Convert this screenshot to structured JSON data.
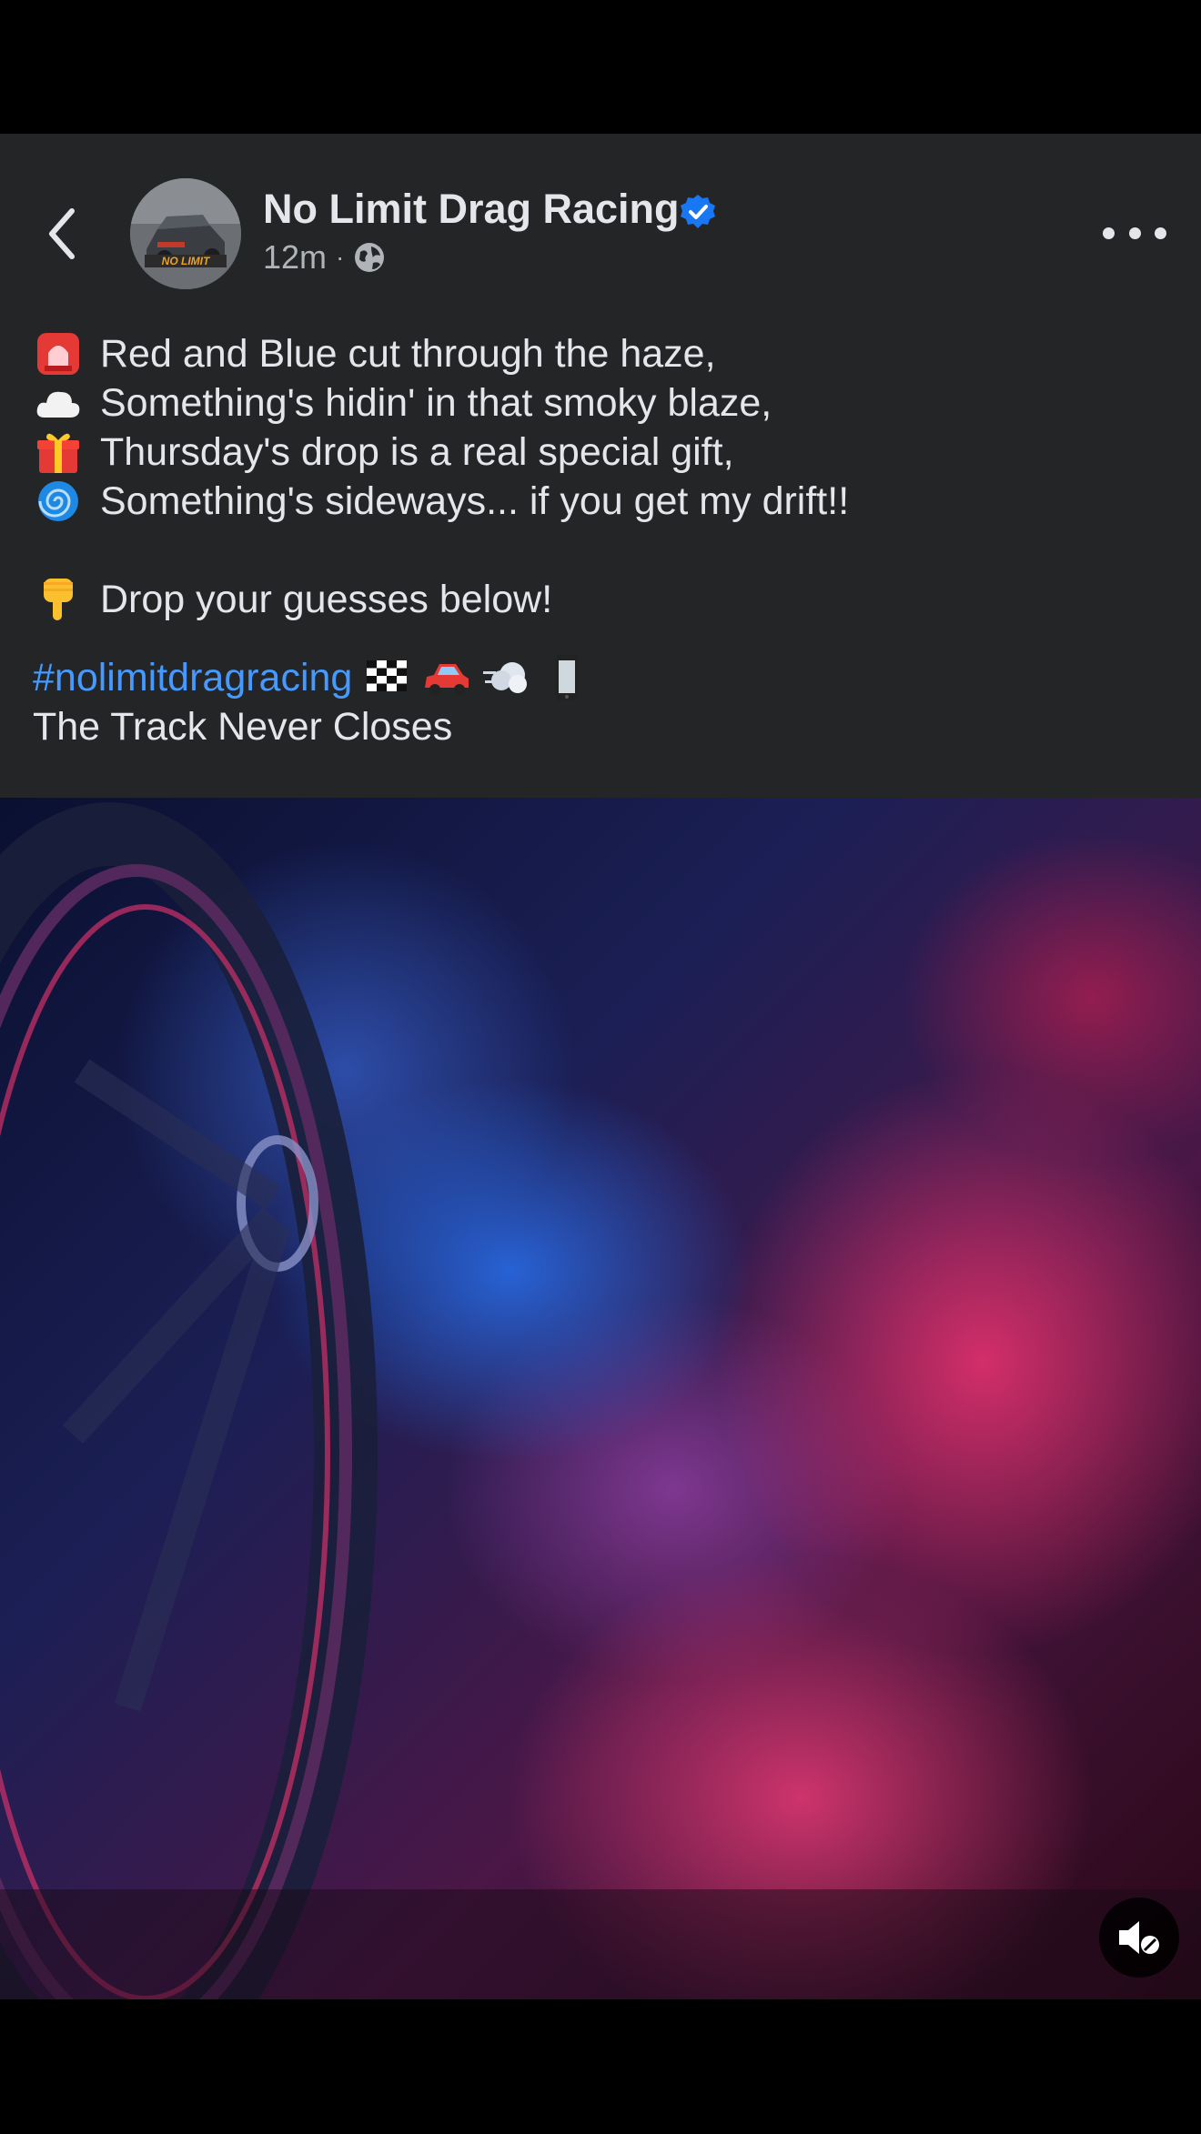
{
  "post": {
    "page_name": "No Limit Drag Racing",
    "time": "12m",
    "separator": "·",
    "caption_lines": [
      {
        "emoji_icon": "rotating-light-icon",
        "text": "Red and Blue cut through the haze,"
      },
      {
        "emoji_icon": "cloud-icon",
        "text": "Something's hidin' in that smoky blaze,"
      },
      {
        "emoji_icon": "gift-icon",
        "text": "Thursday's drop is a real special gift,"
      },
      {
        "emoji_icon": "cyclone-icon",
        "text": "Something's sideways... if you get my drift!!"
      }
    ],
    "cta": {
      "emoji_icon": "pointing-down-icon",
      "text": "Drop your guesses below!"
    },
    "hashtag": "#nolimitdragracing",
    "tag_emojis": [
      "checkered-flag-icon",
      "red-car-icon",
      "dash-icon",
      "phone-icon"
    ],
    "tagline": "The Track Never Closes",
    "avatar_text": "NO LIMIT"
  },
  "icons": {
    "back": "chevron-left-icon",
    "verified": "verified-badge-icon",
    "audience": "globe-icon",
    "more": "more-options-icon",
    "mute": "muted-speaker-icon"
  },
  "colors": {
    "post_background": "#242526",
    "text": "#e4e6eb",
    "secondary_text": "#b0b3b8",
    "hashtag": "#4599ff",
    "verified": "#1877f2"
  }
}
